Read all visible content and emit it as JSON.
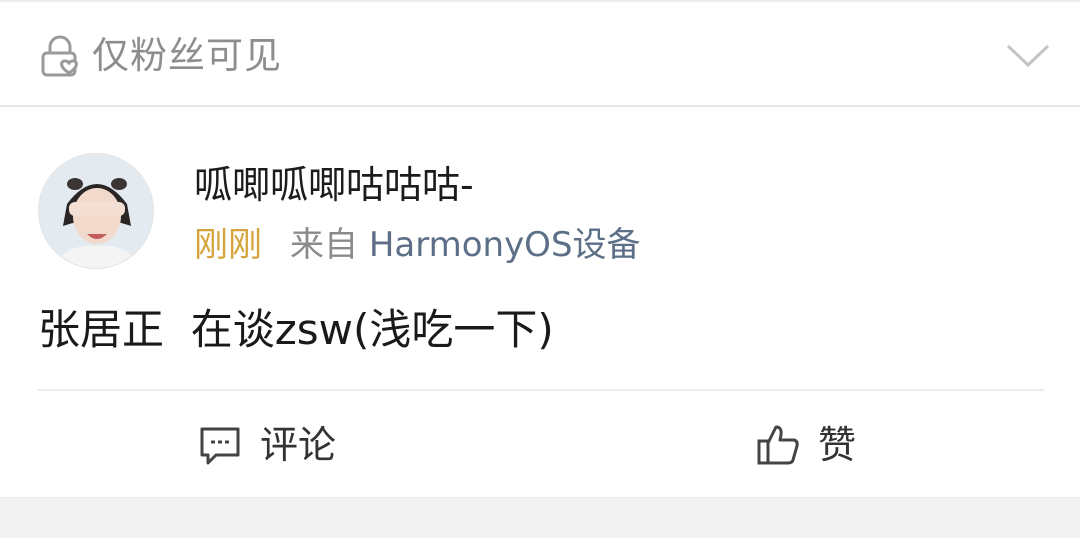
{
  "visibility": {
    "label": "仅粉丝可见",
    "icon": "lock-heart-icon",
    "expand_icon": "chevron-down-icon"
  },
  "post": {
    "author": "呱唧呱唧咕咕咕-",
    "time": "刚刚",
    "source_prefix": "来自 ",
    "source_device": "HarmonyOS设备",
    "body": "张居正  在谈zsw(浅吃一下)"
  },
  "actions": {
    "comment_label": "评论",
    "like_label": "赞",
    "comment_icon": "comment-icon",
    "like_icon": "thumbs-up-icon"
  },
  "colors": {
    "time": "#d4a53a",
    "device": "#5c6f86",
    "muted": "#8b8b8b"
  }
}
